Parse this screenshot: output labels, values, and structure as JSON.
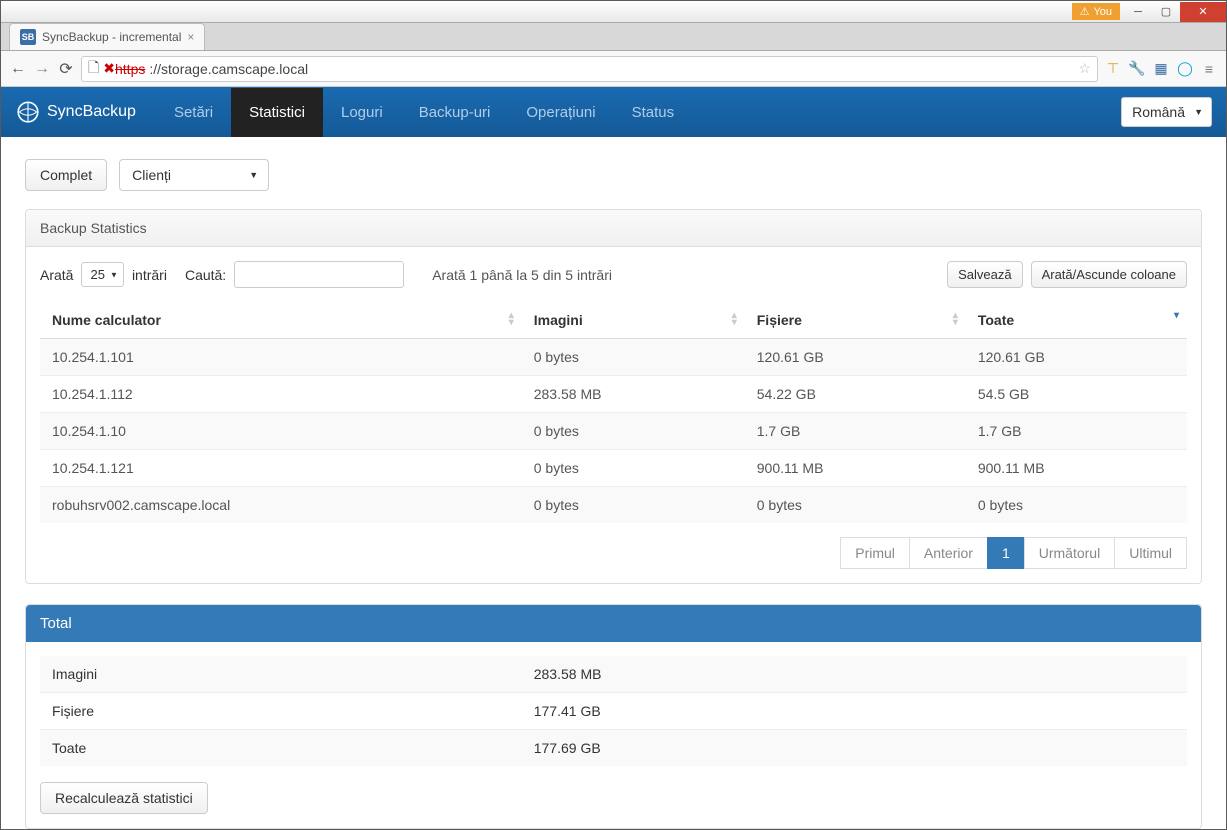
{
  "window": {
    "user_badge": "You",
    "tab_title": "SyncBackup - incremental",
    "url_scheme_bad": "https",
    "url_rest": "://storage.camscape.local",
    "favicon_text": "SB"
  },
  "nav": {
    "brand": "SyncBackup",
    "items": [
      "Setări",
      "Statistici",
      "Loguri",
      "Backup-uri",
      "Operațiuni",
      "Status"
    ],
    "active_index": 1,
    "language": "Română"
  },
  "toolbar": {
    "complete_btn": "Complet",
    "filter_select": "Clienți"
  },
  "panel": {
    "title": "Backup Statistics",
    "show_label": "Arată",
    "page_size": "25",
    "entries_label": "intrări",
    "search_label": "Caută:",
    "info_text": "Arată 1 până la 5 din 5 intrări",
    "save_btn": "Salvează",
    "columns_btn": "Arată/Ascunde coloane"
  },
  "table": {
    "headers": [
      "Nume calculator",
      "Imagini",
      "Fișiere",
      "Toate"
    ],
    "rows": [
      {
        "name": "10.254.1.101",
        "images": "0 bytes",
        "files": "120.61 GB",
        "total": "120.61 GB"
      },
      {
        "name": "10.254.1.112",
        "images": "283.58 MB",
        "files": "54.22 GB",
        "total": "54.5 GB"
      },
      {
        "name": "10.254.1.10",
        "images": "0 bytes",
        "files": "1.7 GB",
        "total": "1.7 GB"
      },
      {
        "name": "10.254.1.121",
        "images": "0 bytes",
        "files": "900.11 MB",
        "total": "900.11 MB"
      },
      {
        "name": "robuhsrv002.camscape.local",
        "images": "0 bytes",
        "files": "0 bytes",
        "total": "0 bytes"
      }
    ]
  },
  "pagination": {
    "first": "Primul",
    "prev": "Anterior",
    "page": "1",
    "next": "Următorul",
    "last": "Ultimul"
  },
  "totals": {
    "title": "Total",
    "rows": [
      {
        "label": "Imagini",
        "value": "283.58 MB"
      },
      {
        "label": "Fișiere",
        "value": "177.41 GB"
      },
      {
        "label": "Toate",
        "value": "177.69 GB"
      }
    ],
    "recalc_btn": "Recalculează statistici"
  }
}
